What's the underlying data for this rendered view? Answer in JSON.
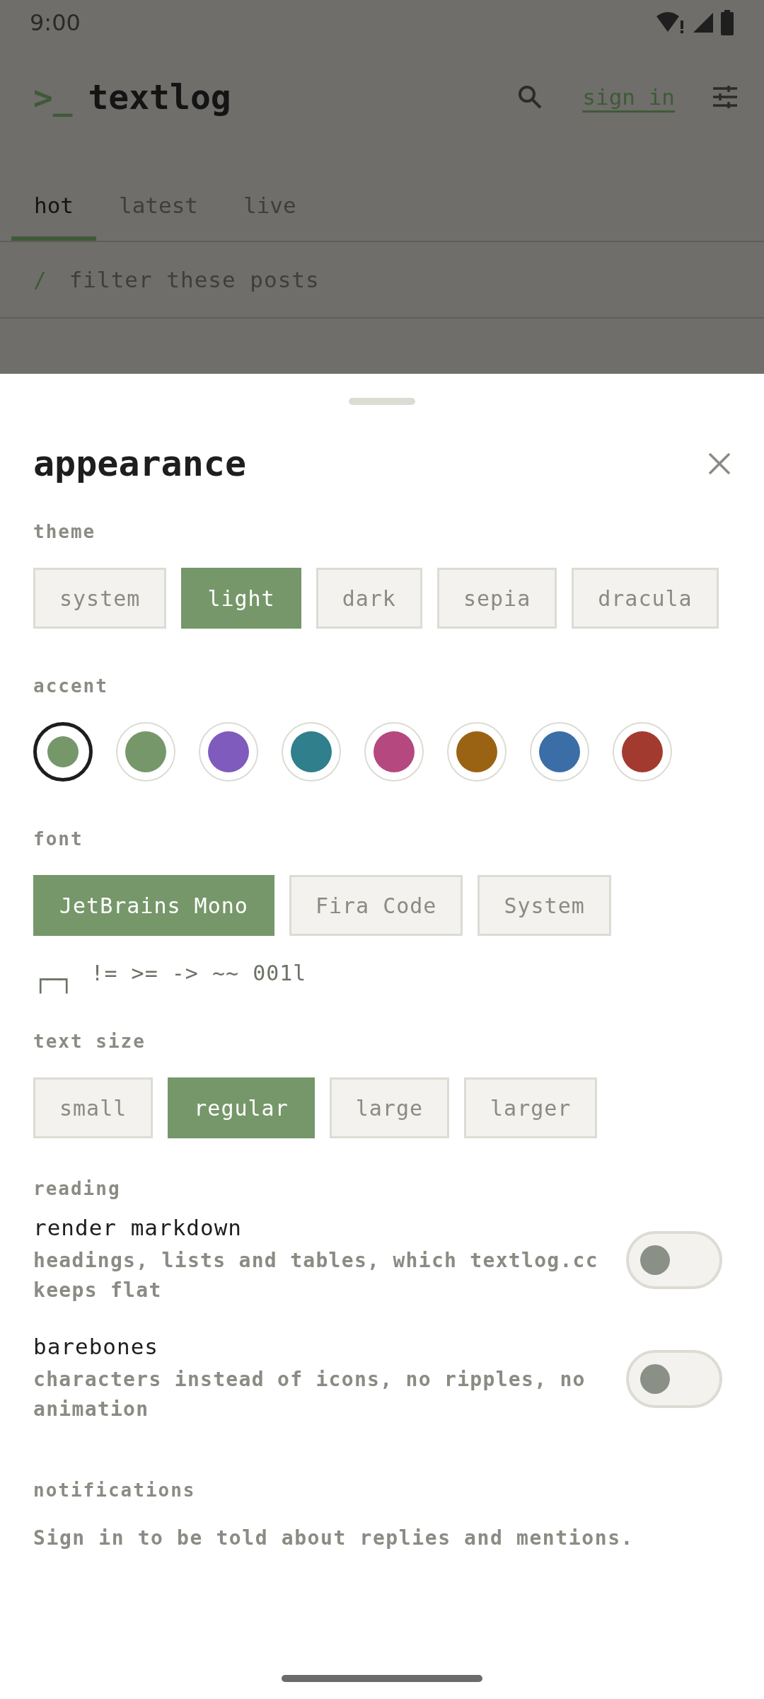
{
  "status_bar": {
    "time": "9:00"
  },
  "header": {
    "logo_prompt": ">_",
    "title": "textlog",
    "sign_in": "sign in"
  },
  "tabs": [
    {
      "label": "hot",
      "selected": true
    },
    {
      "label": "latest",
      "selected": false
    },
    {
      "label": "live",
      "selected": false
    }
  ],
  "filter": {
    "prompt": "/",
    "placeholder": "filter these posts"
  },
  "sheet": {
    "title": "appearance",
    "theme": {
      "label": "theme",
      "options": [
        {
          "label": "system",
          "selected": false
        },
        {
          "label": "light",
          "selected": true
        },
        {
          "label": "dark",
          "selected": false
        },
        {
          "label": "sepia",
          "selected": false
        },
        {
          "label": "dracula",
          "selected": false
        }
      ]
    },
    "accent": {
      "label": "accent",
      "swatches": [
        {
          "color": "#76976a",
          "selected": true
        },
        {
          "color": "#76976a",
          "selected": false
        },
        {
          "color": "#7e5bbd",
          "selected": false
        },
        {
          "color": "#2f7f8c",
          "selected": false
        },
        {
          "color": "#b4487f",
          "selected": false
        },
        {
          "color": "#9a6314",
          "selected": false
        },
        {
          "color": "#3b6ea6",
          "selected": false
        },
        {
          "color": "#a33a30",
          "selected": false
        }
      ]
    },
    "font": {
      "label": "font",
      "options": [
        {
          "label": "JetBrains Mono",
          "selected": true
        },
        {
          "label": "Fira Code",
          "selected": false
        },
        {
          "label": "System",
          "selected": false
        }
      ],
      "preview_glyph": "┌─┐",
      "preview": "!= >= -> ~~ 001l"
    },
    "text_size": {
      "label": "text size",
      "options": [
        {
          "label": "small",
          "selected": false
        },
        {
          "label": "regular",
          "selected": true
        },
        {
          "label": "large",
          "selected": false
        },
        {
          "label": "larger",
          "selected": false
        }
      ]
    },
    "reading": {
      "label": "reading",
      "settings": [
        {
          "title": "render markdown",
          "description": "headings, lists and tables, which textlog.cc keeps flat",
          "on": false
        },
        {
          "title": "barebones",
          "description": "characters instead of icons, no ripples, no animation",
          "on": false
        }
      ]
    },
    "notifications": {
      "label": "notifications",
      "message": "Sign in to be told about replies and mentions."
    }
  }
}
